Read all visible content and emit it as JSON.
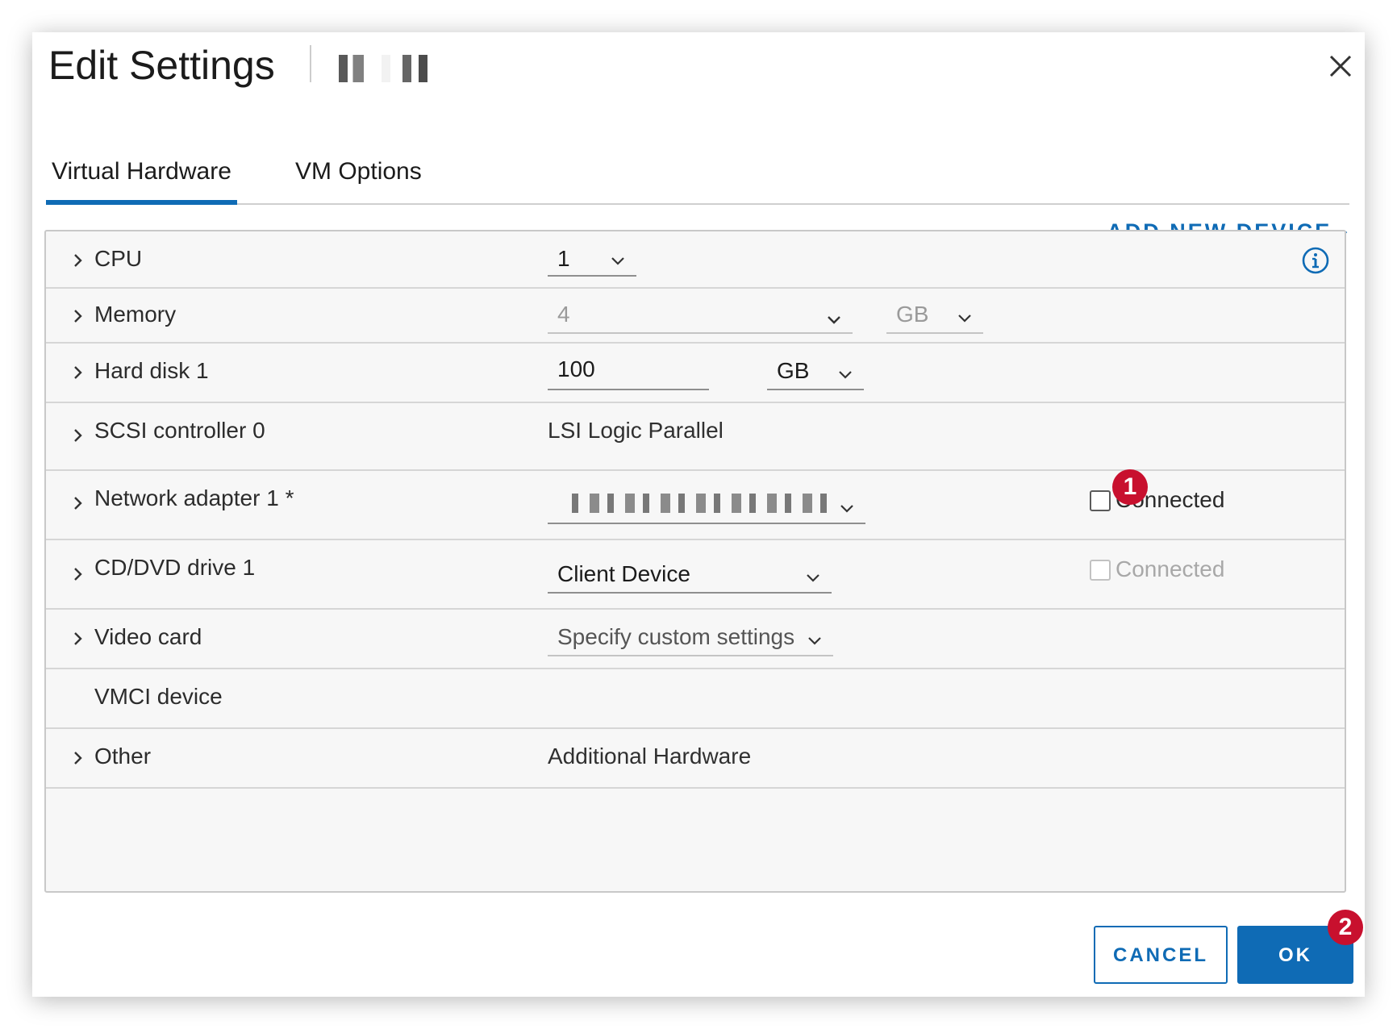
{
  "dialog": {
    "title": "Edit Settings",
    "close_icon": "close-icon"
  },
  "tabs": [
    {
      "label": "Virtual Hardware",
      "active": true
    },
    {
      "label": "VM Options",
      "active": false
    }
  ],
  "add_new_device": "ADD NEW DEVICE",
  "colors": {
    "accent": "#0f6bb5",
    "badge": "#c8102e"
  },
  "rows": {
    "cpu": {
      "label": "CPU",
      "value": "1"
    },
    "memory": {
      "label": "Memory",
      "value": "4",
      "unit": "GB"
    },
    "hard_disk": {
      "label": "Hard disk 1",
      "value": "100",
      "unit": "GB"
    },
    "scsi": {
      "label": "SCSI controller 0",
      "value": "LSI Logic Parallel"
    },
    "network": {
      "label": "Network adapter 1 *",
      "connected_label": "Connected",
      "connected": false
    },
    "cddvd": {
      "label": "CD/DVD drive 1",
      "value": "Client Device",
      "connected_label": "Connected",
      "connected": false
    },
    "video": {
      "label": "Video card",
      "value": "Specify custom settings"
    },
    "vmci": {
      "label": "VMCI device"
    },
    "other": {
      "label": "Other",
      "value": "Additional Hardware"
    }
  },
  "badges": {
    "first": "1",
    "second": "2"
  },
  "buttons": {
    "cancel": "CANCEL",
    "ok": "OK"
  }
}
